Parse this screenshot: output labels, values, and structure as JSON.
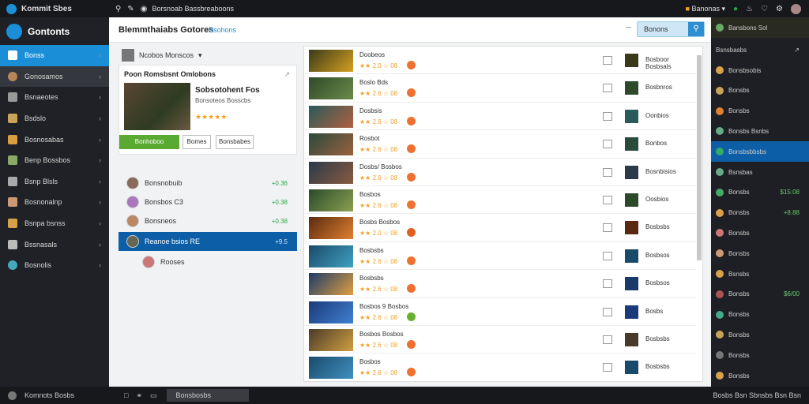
{
  "app": {
    "title": "Kommit Sbes"
  },
  "topbar": {
    "path": "Borsnoab Bassbreaboons",
    "user_label": "Banonas"
  },
  "sidebar": {
    "header": "Gontonts",
    "items": [
      {
        "label": "Bonss",
        "active": true
      },
      {
        "label": "Gonosamos",
        "selected": true
      },
      {
        "label": "Bsnaeotes"
      },
      {
        "label": "Bsdslo"
      },
      {
        "label": "Bosnosabas"
      },
      {
        "label": "Benp Bossbos"
      },
      {
        "label": "Bsnp Blsls"
      },
      {
        "label": "Bosnonalnp"
      },
      {
        "label": "Bsnpa bsnss"
      },
      {
        "label": "Bssnasals"
      },
      {
        "label": "Bosnolis"
      }
    ]
  },
  "header": {
    "title": "Blemmthaiabs Gotores",
    "breadcrumb": "Bsohons",
    "search_label": "Bonons"
  },
  "left_panel": {
    "dropdown_label": "Ncobos Monscos",
    "card": {
      "title": "Poon Romsbsnt Omlobons",
      "player_name": "Sobsotohent Fos",
      "player_meta": "Bonsoteos Bosscbs",
      "rating_text": "★★★★★",
      "buttons": [
        "Bonhoboo",
        "Bomes",
        "Bonsbabes"
      ]
    },
    "friends": [
      {
        "name": "Bonsnobuib",
        "value": "+0.36"
      },
      {
        "name": "Bonsbos C3",
        "value": "+0.38"
      },
      {
        "name": "Bonsneos",
        "value": "+0.38"
      },
      {
        "name": "Reanoe bsios RE",
        "value": "+9.5",
        "selected": true
      },
      {
        "name": "Rooses"
      }
    ]
  },
  "games": [
    {
      "name": "Doobeos",
      "rating": "★★ 2.0 ☆ 08",
      "other": "Bosboor Bosbsals"
    },
    {
      "name": "Boslo Bds",
      "rating": "★★ 2.6 ☆ 08",
      "other": "Bosbnros"
    },
    {
      "name": "Dosbsis",
      "rating": "★★ 2.6 ☆ 08",
      "other": "Oonbios"
    },
    {
      "name": "Rosbot",
      "rating": "★★ 2.6 ☆ 08",
      "other": "Bonbos"
    },
    {
      "name": "Dosbs/ Bosbos",
      "rating": "★★ 2.6 ☆ 08",
      "other": "Bosnbisios"
    },
    {
      "name": "Bosbos",
      "rating": "★★ 2.6 ☆ 08",
      "other": "Oosbios"
    },
    {
      "name": "Bosbs Bosbos",
      "rating": "★★ 2.0 ☆ 08",
      "other": "Bosbsbs"
    },
    {
      "name": "Bosbsbs",
      "rating": "★★ 2.6 ☆ 08",
      "other": "Bosbsos"
    },
    {
      "name": "Bosbsbs",
      "rating": "★★ 2.6 ☆ 08",
      "other": "Bosbsos"
    },
    {
      "name": "Bosbos 9 Bosbos",
      "rating": "★★ 2.6 ☆ 08",
      "other": "Bosbs"
    },
    {
      "name": "Bosbos Bosbos",
      "rating": "★★ 2.6 ☆ 08",
      "other": "Bosbsbs"
    },
    {
      "name": "Bosbos",
      "rating": "★★ 2.6 ☆ 08",
      "other": "Bosbsbs"
    }
  ],
  "right_panel": {
    "header": "Bansbons Sol",
    "section_label": "Bsnsbasbs",
    "rows": [
      {
        "name": "Bonsbsobis",
        "value": ""
      },
      {
        "name": "Bonsbs",
        "value": ""
      },
      {
        "name": "Bonsbs",
        "value": ""
      },
      {
        "name": "Bonsbs Bsnbs",
        "value": ""
      },
      {
        "name": "Bonsbsbbsbs",
        "value": "",
        "selected": true
      },
      {
        "name": "Bsnsbas",
        "value": ""
      },
      {
        "name": "Bonsbs",
        "value": "$15:08"
      },
      {
        "name": "Bonsbs",
        "value": "+8.88"
      },
      {
        "name": "Bonsbs",
        "value": ""
      },
      {
        "name": "Bonsbs",
        "value": ""
      },
      {
        "name": "Bsnsbs",
        "value": ""
      },
      {
        "name": "Bonsbs",
        "value": "$6/00"
      },
      {
        "name": "Bonsbs",
        "value": ""
      },
      {
        "name": "Bonsbs",
        "value": ""
      },
      {
        "name": "Bonsbs",
        "value": ""
      },
      {
        "name": "Bonsbs",
        "value": ""
      }
    ]
  },
  "bottombar": {
    "left_label": "Komnots Bosbs",
    "status_label": "Bonsbosbs",
    "right_label": "Bosbs Bsn Sbnsbs Bsn Bsn"
  },
  "colors": {
    "accent": "#1a8fd8",
    "selected_dark": "#0c5fa6",
    "star": "#f0a020",
    "positive": "#27a844"
  }
}
